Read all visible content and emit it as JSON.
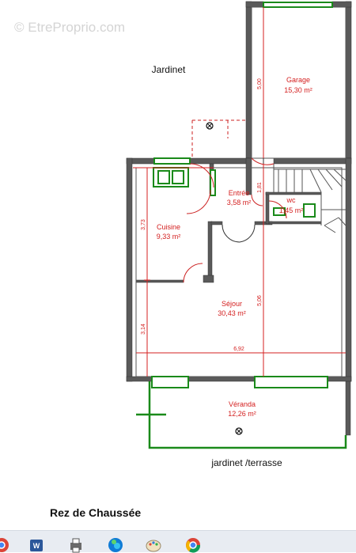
{
  "watermark": "© EtreProprio.com",
  "heading": "Rez de Chaussée",
  "labels": {
    "jardinet": "Jardinet",
    "garden_terrace": "jardinet /terrasse"
  },
  "rooms": {
    "garage": {
      "name": "Garage",
      "area": "15,30 m²"
    },
    "entree": {
      "name": "Entrée",
      "area": "3,58 m²"
    },
    "wc": {
      "name": "wc",
      "area": "1,45 m²"
    },
    "cuisine": {
      "name": "Cuisine",
      "area": "9,33 m²"
    },
    "sejour": {
      "name": "Séjour",
      "area": "30,43 m²"
    },
    "veranda": {
      "name": "Véranda",
      "area": "12,26 m²"
    }
  },
  "dimensions": {
    "garage_depth": "5,00",
    "entree_width": "1,81",
    "cuisine_depth": "3,73",
    "sejour_depth": "5,06",
    "lower_depth": "3,14",
    "total_width": "6,92"
  },
  "colors": {
    "wall": "#555555",
    "window": "#1a8a1a",
    "dimension": "#d42020",
    "door": "#cc2222"
  },
  "taskbar_icons": [
    "chrome-icon",
    "word-icon",
    "printer-icon",
    "edge-icon",
    "paint-icon",
    "chrome-icon"
  ]
}
